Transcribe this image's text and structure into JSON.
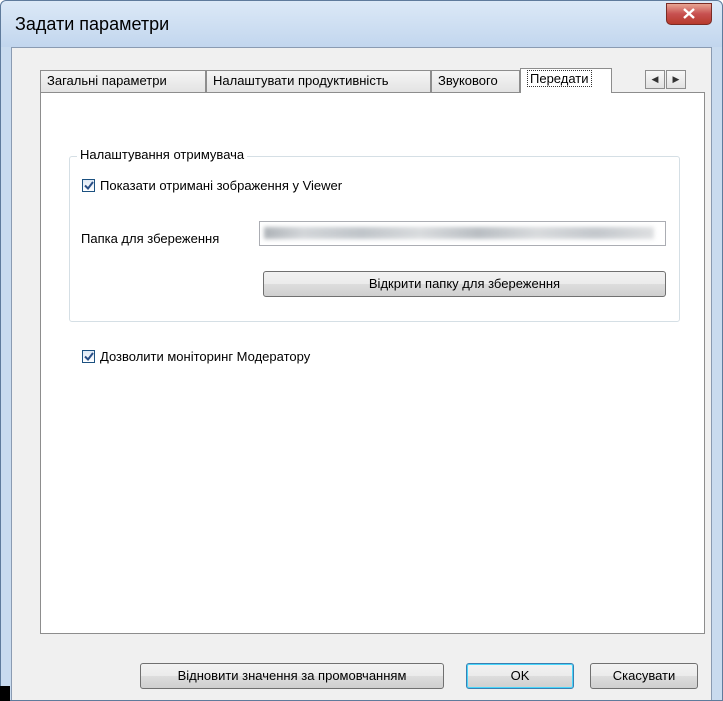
{
  "window": {
    "title": "Задати параметри"
  },
  "tabs": [
    {
      "label": "Загальні параметри"
    },
    {
      "label": "Налаштувати продуктивність"
    },
    {
      "label": "Звукового"
    },
    {
      "label": "Передати"
    }
  ],
  "active_tab": "Передати",
  "receiver_group": {
    "title": "Налаштування отримувача",
    "show_in_viewer": {
      "label": "Показати отримані зображення у Viewer",
      "checked": true
    },
    "save_folder": {
      "label": "Папка для збереження",
      "value": ""
    },
    "open_folder_button": "Відкрити папку для збереження"
  },
  "allow_monitoring": {
    "label": "Дозволити моніторинг Модератору",
    "checked": true
  },
  "footer": {
    "restore_defaults": "Відновити значення за промовчанням",
    "ok": "OK",
    "cancel": "Скасувати"
  },
  "icons": {
    "close": "close-icon",
    "tab_scroll_left": "chevron-left-icon",
    "tab_scroll_right": "chevron-right-icon",
    "check": "check-icon"
  },
  "colors": {
    "frame": "#c9dbef",
    "close_button": "#c75050",
    "checkbox_border": "#1c5180"
  }
}
